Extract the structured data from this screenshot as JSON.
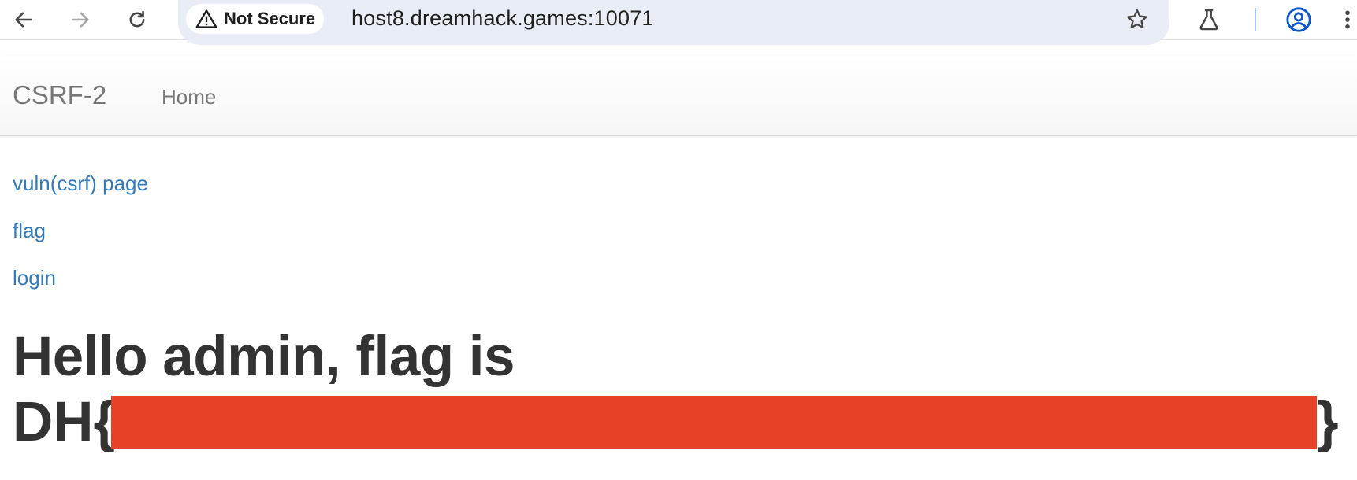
{
  "browser": {
    "security_label": "Not Secure",
    "url": "host8.dreamhack.games:10071",
    "icons": [
      "back-icon",
      "forward-icon",
      "reload-icon",
      "warning-icon",
      "star-icon",
      "labs-icon",
      "profile-icon",
      "more-icon"
    ]
  },
  "navbar": {
    "brand": "CSRF-2",
    "home": "Home"
  },
  "links": {
    "vuln": "vuln(csrf) page",
    "flag": "flag",
    "login": "login"
  },
  "main": {
    "greeting": "Hello admin, flag is",
    "flag_prefix": "DH{",
    "flag_suffix": "}",
    "redaction_color": "#e84128"
  }
}
